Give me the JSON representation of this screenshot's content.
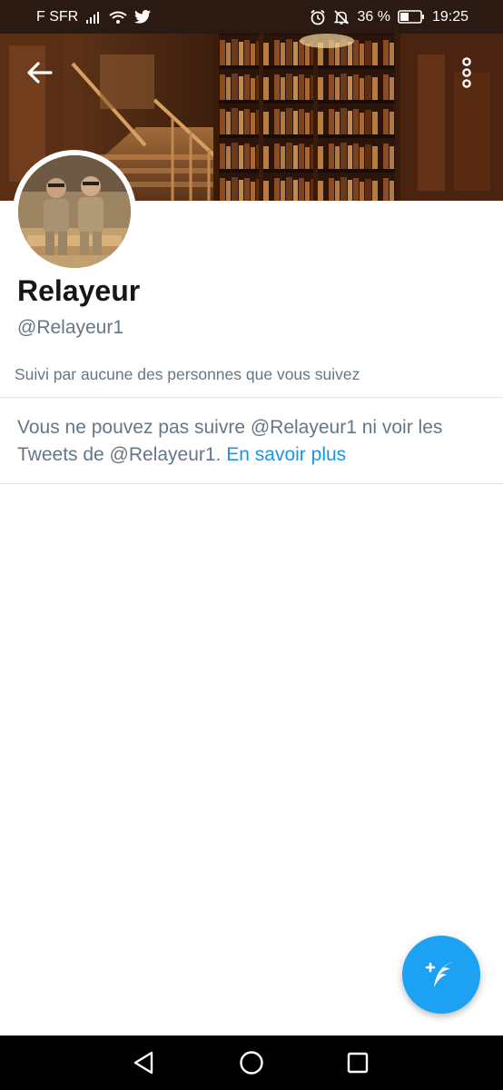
{
  "status_bar": {
    "carrier": "F SFR",
    "battery_percent": "36 %",
    "time": "19:25",
    "icons": [
      "signal-icon",
      "wifi-icon",
      "twitter-icon",
      "alarm-icon",
      "bell-off-icon",
      "battery-icon"
    ]
  },
  "header": {
    "back_icon": "back-arrow-icon",
    "more_icon": "more-vertical-icon"
  },
  "profile": {
    "name": "Relayeur",
    "handle": "@Relayeur1",
    "followed_by": "Suivi par aucune des personnes que vous suivez"
  },
  "blocked_notice": {
    "text": "Vous ne pouvez pas suivre @Relayeur1 ni voir les Tweets de @Relayeur1.",
    "link_label": "En savoir plus"
  },
  "compose": {
    "icon": "compose-tweet-icon"
  },
  "nav": {
    "icons": [
      "nav-back-icon",
      "nav-home-icon",
      "nav-recents-icon"
    ]
  },
  "colors": {
    "link": "#1b95e0",
    "fab": "#1da1f2",
    "text_primary": "#14171a",
    "text_secondary": "#657786"
  }
}
